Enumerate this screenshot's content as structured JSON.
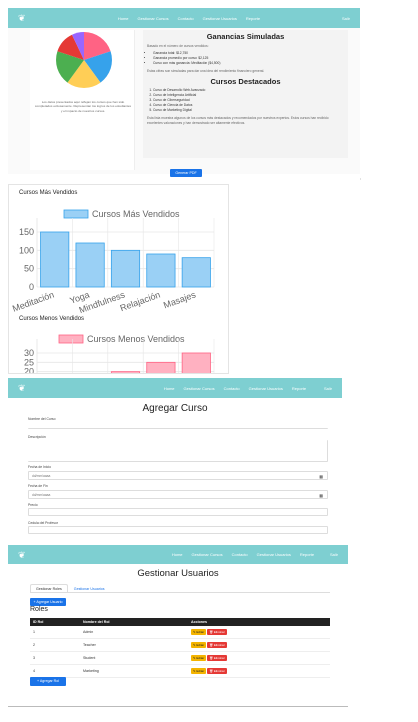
{
  "nav": {
    "logo_icon": "leaf-logo-icon",
    "links": [
      "Home",
      "Gestionar Cursos",
      "Contacto",
      "Gestionar Usuarios",
      "Reporte"
    ],
    "logout": "Salir"
  },
  "report": {
    "pie_text": "Los datos presentados aquí reflejan los cursos que han sido completados exitosamente. Representan los logros de los estudiantes y el impacto de nuestros cursos.",
    "earnings": {
      "title": "Ganancias Simuladas",
      "intro": "Basado en el número de cursos vendidos:",
      "items": [
        "Ganancia total: $12,750",
        "Ganancia promedio por curso: $2,125",
        "Curso con más ganancia: Meditación ($4,500)"
      ],
      "note": "Estas cifras son simuladas para dar una idea del rendimiento financiero general."
    },
    "featured": {
      "title": "Cursos Destacados",
      "items": [
        "Curso de Desarrollo Web Avanzado",
        "Curso de Inteligencia Artificial",
        "Curso de Ciberseguridad",
        "Curso de Ciencia de Datos",
        "Curso de Marketing Digital"
      ],
      "note": "Esta lista muestra algunos de los cursos más destacados y recomendados por nuestros expertos. Estos cursos han recibido excelentes valoraciones y han demostrado ser altamente efectivos."
    },
    "pdf_button": "Generar PDF",
    "pie_colors": [
      "#ff6384",
      "#36a2eb",
      "#ffce56",
      "#4bc0c0",
      "#9966ff",
      "#ff9f40"
    ],
    "pie_order": [
      "#ff6384",
      "#36a2eb",
      "#ffce56",
      "#4caf50",
      "#e53935",
      "#ff9f40"
    ]
  },
  "charts": {
    "best_heading": "Cursos Más Vendidos",
    "worst_heading": "Cursos Menos Vendidos"
  },
  "chart_data": [
    {
      "type": "bar",
      "title": "Cursos Más Vendidos",
      "legend": "Cursos Más Vendidos",
      "categories": [
        "Meditación",
        "Yoga",
        "Mindfulness",
        "Relajación",
        "Masajes"
      ],
      "values": [
        150,
        120,
        100,
        90,
        80
      ],
      "ylim": [
        0,
        150
      ],
      "yticks": [
        0,
        50,
        100,
        150
      ],
      "color": "#9ad0f5",
      "border": "#36a2eb",
      "grid": true
    },
    {
      "type": "bar",
      "title": "Cursos Menos Vendidos",
      "legend": "Cursos Menos Vendidos",
      "categories": [
        "",
        "",
        "",
        "",
        ""
      ],
      "values": [
        5,
        10,
        20,
        25,
        30
      ],
      "yticks": [
        20,
        25,
        30
      ],
      "color": "#ffb1c1",
      "border": "#ff6384",
      "grid": true
    }
  ],
  "add_course": {
    "title": "Agregar Curso",
    "fields": {
      "name_label": "Nombre del Curso",
      "desc_label": "Descripción",
      "start_label": "Fecha de Inicio",
      "start_placeholder": "dd/mm/aaaa",
      "end_label": "Fecha de Fin",
      "end_placeholder": "dd/mm/aaaa",
      "price_label": "Precio",
      "teacher_label": "Cedula del Profesor"
    }
  },
  "users": {
    "title": "Gestionar Usuarios",
    "tabs": [
      "Gestionar Roles",
      "Gestionar Usuarios"
    ],
    "add_user": "+ Agregar Usuario",
    "roles_heading": "Roles",
    "columns": [
      "ID Rol",
      "Nombre del Rol",
      "Acciones"
    ],
    "rows": [
      {
        "id": "1",
        "name": "Admin"
      },
      {
        "id": "2",
        "name": "Teacher"
      },
      {
        "id": "3",
        "name": "Student"
      },
      {
        "id": "4",
        "name": "Marketing"
      }
    ],
    "edit_label": "Editar",
    "delete_label": "Eliminar",
    "add_role": "+ Agregar Rol"
  }
}
